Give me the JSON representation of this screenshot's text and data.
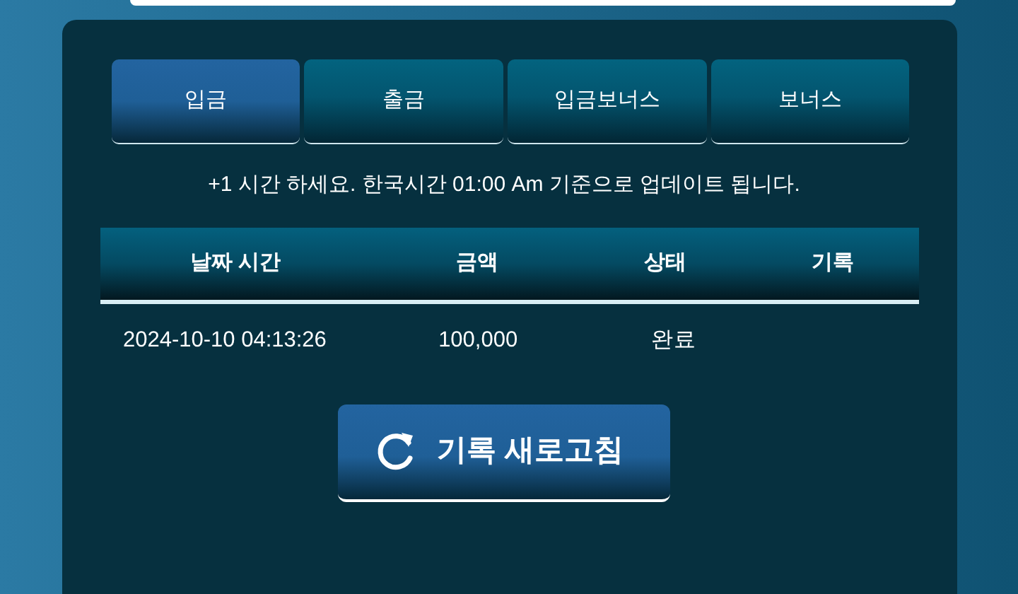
{
  "tabs": [
    {
      "label": "입금",
      "selected": true
    },
    {
      "label": "출금",
      "selected": false
    },
    {
      "label": "입금보너스",
      "selected": false
    },
    {
      "label": "보너스",
      "selected": false
    }
  ],
  "notice": "+1 시간 하세요. 한국시간 01:00 Am 기준으로 업데이트 됩니다.",
  "table": {
    "columns": [
      "날짜 시간",
      "금액",
      "상태",
      "기록"
    ],
    "rows": [
      [
        "2024-10-10 04:13:26",
        "100,000",
        "완료",
        ""
      ]
    ]
  },
  "refresh_button": "기록 새로고침"
}
